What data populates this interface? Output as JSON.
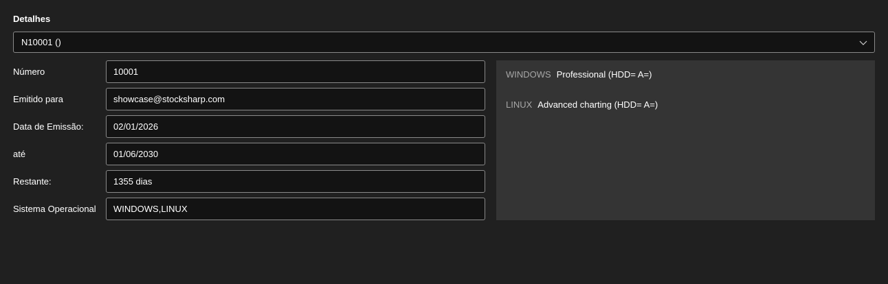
{
  "section": {
    "title": "Detalhes"
  },
  "selector": {
    "value": "N10001 ()",
    "icon": "chevron-down-icon"
  },
  "fields": [
    {
      "name": "numero",
      "label": "Número",
      "value": "10001"
    },
    {
      "name": "emitido-para",
      "label": "Emitido para",
      "value": "showcase@stocksharp.com"
    },
    {
      "name": "data-emissao",
      "label": "Data de Emissão:",
      "value": "02/01/2026"
    },
    {
      "name": "ate",
      "label": "até",
      "value": "01/06/2030"
    },
    {
      "name": "restante",
      "label": "Restante:",
      "value": "1355 dias"
    },
    {
      "name": "sistema-operacional",
      "label": "Sistema Operacional",
      "value": "WINDOWS,LINUX"
    }
  ],
  "features": [
    {
      "os": "WINDOWS",
      "description": "Professional (HDD= A=)"
    },
    {
      "os": "LINUX",
      "description": "Advanced charting (HDD= A=)"
    }
  ]
}
